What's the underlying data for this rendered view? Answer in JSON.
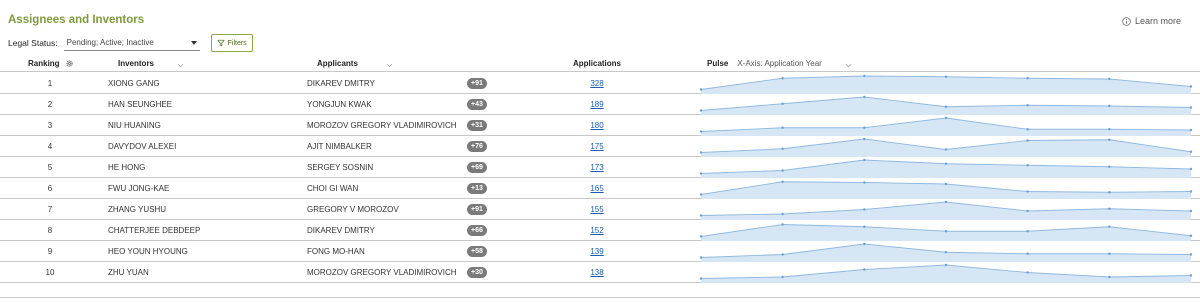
{
  "header": {
    "title": "Assignees and Inventors",
    "learn_more": "Learn more"
  },
  "filters": {
    "legal_status_label": "Legal Status:",
    "legal_status_value": "Pending; Active; Inactive",
    "filters_button": "Filters"
  },
  "columns": {
    "ranking": "Ranking",
    "inventors": "Inventors",
    "applicants": "Applicants",
    "applications": "Applications",
    "pulse": "Pulse",
    "pulse_axis": "X-Axis: Application Year"
  },
  "colors": {
    "title_green": "#7e9a3c",
    "link_blue": "#1a5fb4",
    "badge_gray": "#7a7a7a",
    "pulse_fill": "#d6e6f5",
    "pulse_line": "#8fb8e0"
  },
  "rows": [
    {
      "rank": "1",
      "inventor": "XIONG GANG",
      "applicant": "DIKAREV DMITRY",
      "badge": "+91",
      "applications": "328",
      "pulse": [
        0.1,
        0.85,
        1.0,
        0.95,
        0.85,
        0.8,
        0.3
      ]
    },
    {
      "rank": "2",
      "inventor": "HAN SEUNGHEE",
      "applicant": "YONGJUN KWAK",
      "badge": "+43",
      "applications": "189",
      "pulse": [
        0.1,
        0.55,
        1.0,
        0.35,
        0.45,
        0.4,
        0.3
      ]
    },
    {
      "rank": "3",
      "inventor": "NIU HUANING",
      "applicant": "MOROZOV GREGORY VLADIMIROVICH",
      "badge": "+31",
      "applications": "180",
      "pulse": [
        0.1,
        0.35,
        0.35,
        1.0,
        0.25,
        0.25,
        0.2
      ]
    },
    {
      "rank": "4",
      "inventor": "DAVYDOV ALEXEI",
      "applicant": "AJIT NIMBALKER",
      "badge": "+76",
      "applications": "175",
      "pulse": [
        0.1,
        0.35,
        1.0,
        0.3,
        0.9,
        0.95,
        0.15
      ]
    },
    {
      "rank": "5",
      "inventor": "HE HONG",
      "applicant": "SERGEY SOSNIN",
      "badge": "+69",
      "applications": "173",
      "pulse": [
        0.1,
        0.3,
        1.0,
        0.75,
        0.65,
        0.55,
        0.4
      ]
    },
    {
      "rank": "6",
      "inventor": "FWU JONG-KAE",
      "applicant": "CHOI GI WAN",
      "badge": "+13",
      "applications": "165",
      "pulse": [
        0.1,
        0.95,
        0.9,
        0.8,
        0.3,
        0.25,
        0.3
      ]
    },
    {
      "rank": "7",
      "inventor": "ZHANG YUSHU",
      "applicant": "GREGORY V MOROZOV",
      "badge": "+91",
      "applications": "155",
      "pulse": [
        0.1,
        0.2,
        0.5,
        1.0,
        0.4,
        0.55,
        0.4
      ]
    },
    {
      "rank": "8",
      "inventor": "CHATTERJEE DEBDEEP",
      "applicant": "DIKAREV DMITRY",
      "badge": "+66",
      "applications": "152",
      "pulse": [
        0.1,
        0.9,
        0.75,
        0.45,
        0.45,
        0.75,
        0.15
      ]
    },
    {
      "rank": "9",
      "inventor": "HEO YOUN HYOUNG",
      "applicant": "FONG MO-HAN",
      "badge": "+58",
      "applications": "139",
      "pulse": [
        0.1,
        0.3,
        1.0,
        0.45,
        0.35,
        0.35,
        0.3
      ]
    },
    {
      "rank": "10",
      "inventor": "ZHU YUAN",
      "applicant": "MOROZOV GREGORY VLADIMIROVICH",
      "badge": "+30",
      "applications": "138",
      "pulse": [
        0.1,
        0.2,
        0.7,
        1.0,
        0.5,
        0.2,
        0.3
      ]
    }
  ]
}
